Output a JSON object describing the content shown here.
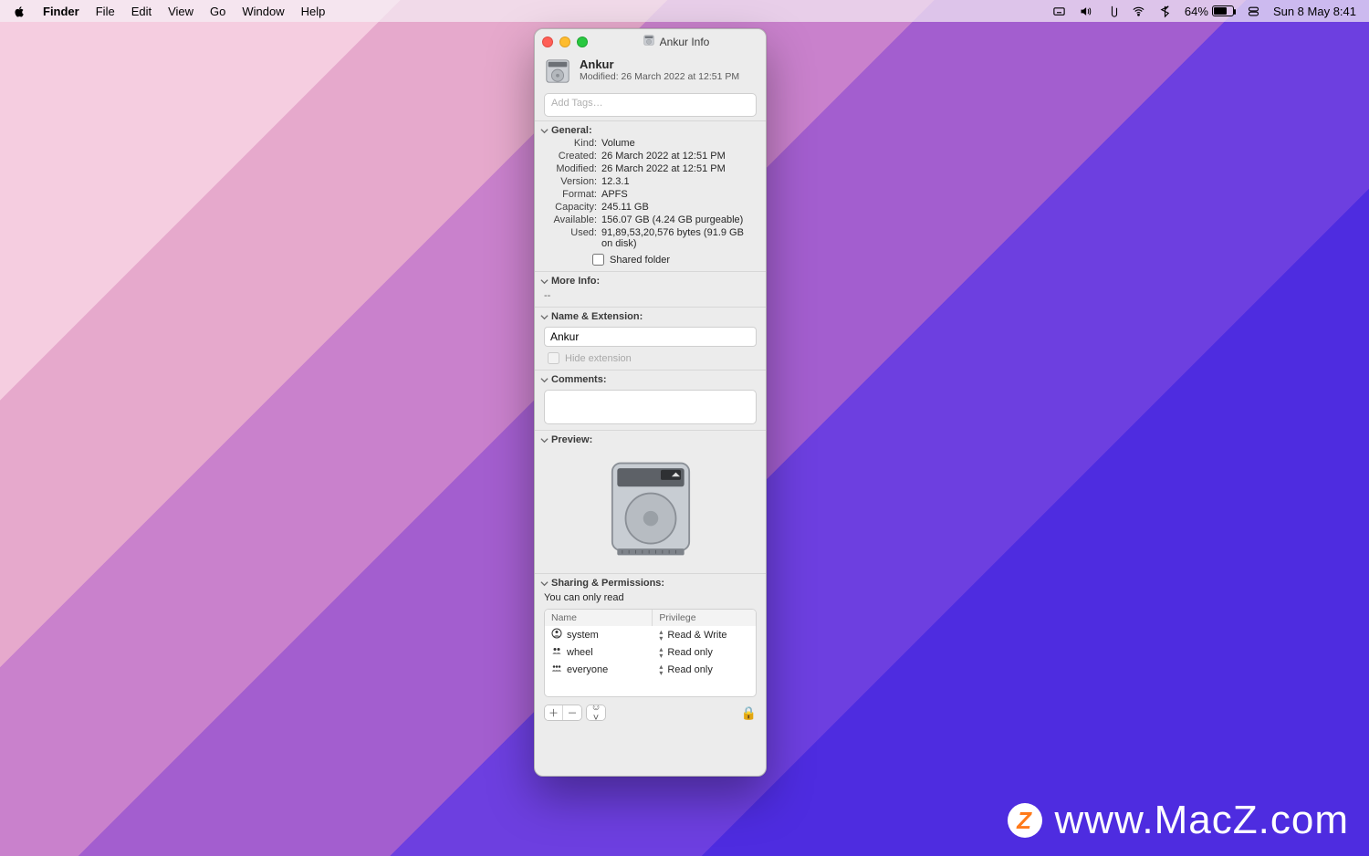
{
  "menubar": {
    "app": "Finder",
    "items": [
      "File",
      "Edit",
      "View",
      "Go",
      "Window",
      "Help"
    ],
    "battery_pct": "64%",
    "datetime": "Sun 8 May  8:41"
  },
  "window": {
    "title": "Ankur Info",
    "header": {
      "name": "Ankur",
      "modified_label": "Modified:",
      "modified_value": "26 March 2022 at 12:51 PM"
    },
    "tags_placeholder": "Add Tags…",
    "sections": {
      "general": {
        "title": "General:",
        "rows": [
          {
            "k": "Kind:",
            "v": "Volume"
          },
          {
            "k": "Created:",
            "v": "26 March 2022 at 12:51 PM"
          },
          {
            "k": "Modified:",
            "v": "26 March 2022 at 12:51 PM"
          },
          {
            "k": "Version:",
            "v": "12.3.1"
          },
          {
            "k": "Format:",
            "v": "APFS"
          },
          {
            "k": "Capacity:",
            "v": "245.11 GB"
          },
          {
            "k": "Available:",
            "v": "156.07 GB (4.24 GB purgeable)"
          },
          {
            "k": "Used:",
            "v": "91,89,53,20,576 bytes (91.9 GB on disk)"
          }
        ],
        "shared_label": "Shared folder"
      },
      "more": {
        "title": "More Info:",
        "value": "--"
      },
      "name_ext": {
        "title": "Name & Extension:",
        "value": "Ankur",
        "hide_label": "Hide extension"
      },
      "comments": {
        "title": "Comments:"
      },
      "preview": {
        "title": "Preview:"
      },
      "sharing": {
        "title": "Sharing & Permissions:",
        "msg": "You can only read",
        "cols": [
          "Name",
          "Privilege"
        ],
        "rows": [
          {
            "icon": "user",
            "name": "system",
            "priv": "Read & Write"
          },
          {
            "icon": "group2",
            "name": "wheel",
            "priv": "Read only"
          },
          {
            "icon": "group3",
            "name": "everyone",
            "priv": "Read only"
          }
        ]
      }
    }
  },
  "watermark": "www.MacZ.com"
}
